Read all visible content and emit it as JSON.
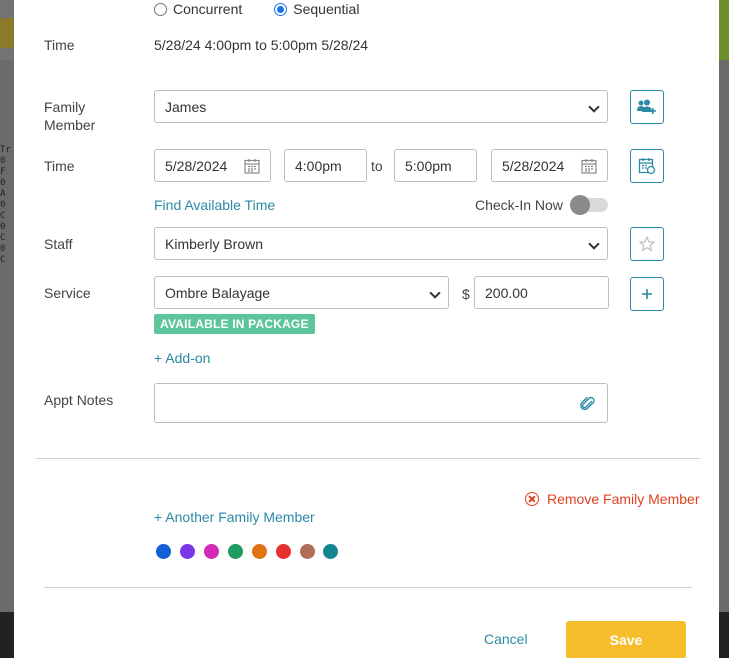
{
  "background": {
    "left_edge_text": [
      "Tr",
      "0 F",
      "0 A",
      "0 C",
      "0 C",
      "0 C"
    ]
  },
  "mode": {
    "options": [
      {
        "label": "Concurrent",
        "selected": false
      },
      {
        "label": "Sequential",
        "selected": true
      }
    ]
  },
  "summary": {
    "time_label": "Time",
    "time_value": "5/28/24 4:00pm to 5:00pm 5/28/24"
  },
  "family_member": {
    "label_line1": "Family",
    "label_line2": "Member",
    "selected": "James"
  },
  "time": {
    "label": "Time",
    "start_date": "5/28/2024",
    "start_time": "4:00pm",
    "to_label": "to",
    "end_time": "5:00pm",
    "end_date": "5/28/2024",
    "find_available_link": "Find Available Time",
    "checkin_label": "Check-In Now",
    "checkin_on": false
  },
  "staff": {
    "label": "Staff",
    "selected": "Kimberly Brown"
  },
  "service": {
    "label": "Service",
    "selected": "Ombre Balayage",
    "currency": "$",
    "price": "200.00",
    "badge": "AVAILABLE IN PACKAGE",
    "addon_link": "+ Add-on"
  },
  "notes": {
    "label": "Appt Notes",
    "value": ""
  },
  "actions": {
    "remove_family_member": "Remove Family Member",
    "another_family_member": "+ Another Family Member",
    "cancel": "Cancel",
    "save": "Save"
  },
  "colors": {
    "accent": "#2b8aa6",
    "save": "#f6be2c",
    "danger": "#e0401f",
    "badge": "#5cc59a",
    "swatches": [
      "#1260d6",
      "#7a35e6",
      "#d42ab8",
      "#1f9a63",
      "#e07214",
      "#e52e2e",
      "#b06e5a",
      "#14868f"
    ]
  }
}
